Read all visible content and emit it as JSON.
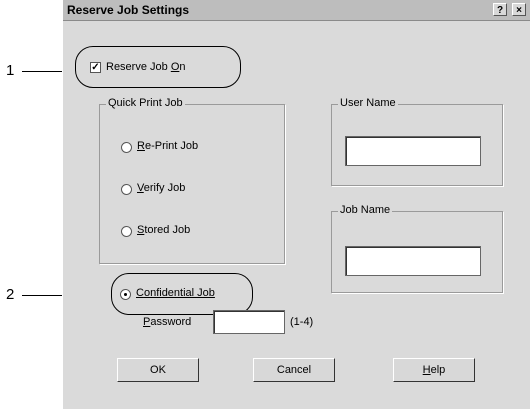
{
  "callouts": [
    "1",
    "2"
  ],
  "dialog": {
    "title": "Reserve Job Settings",
    "help_icon": "?",
    "close_icon": "×",
    "reserve_job": {
      "prefix": "Reserve Job ",
      "accel": "O",
      "suffix": "n",
      "checked": true
    },
    "quick_print_group": "Quick Print Job",
    "radios": [
      {
        "accel": "R",
        "rest": "e-Print Job"
      },
      {
        "accel": "V",
        "rest": "erify Job"
      },
      {
        "accel": "S",
        "rest": "tored Job"
      }
    ],
    "confidential": {
      "accel": "C",
      "rest": "onfidential Job",
      "selected": true
    },
    "password": {
      "accel": "P",
      "rest": "assword",
      "value": "",
      "hint": "(1-4)"
    },
    "user_name_group": "User Name",
    "user_name_value": "",
    "job_name_group": "Job Name",
    "job_name_value": "",
    "buttons": {
      "ok": "OK",
      "cancel": "Cancel",
      "help_accel": "H",
      "help_rest": "elp"
    }
  }
}
